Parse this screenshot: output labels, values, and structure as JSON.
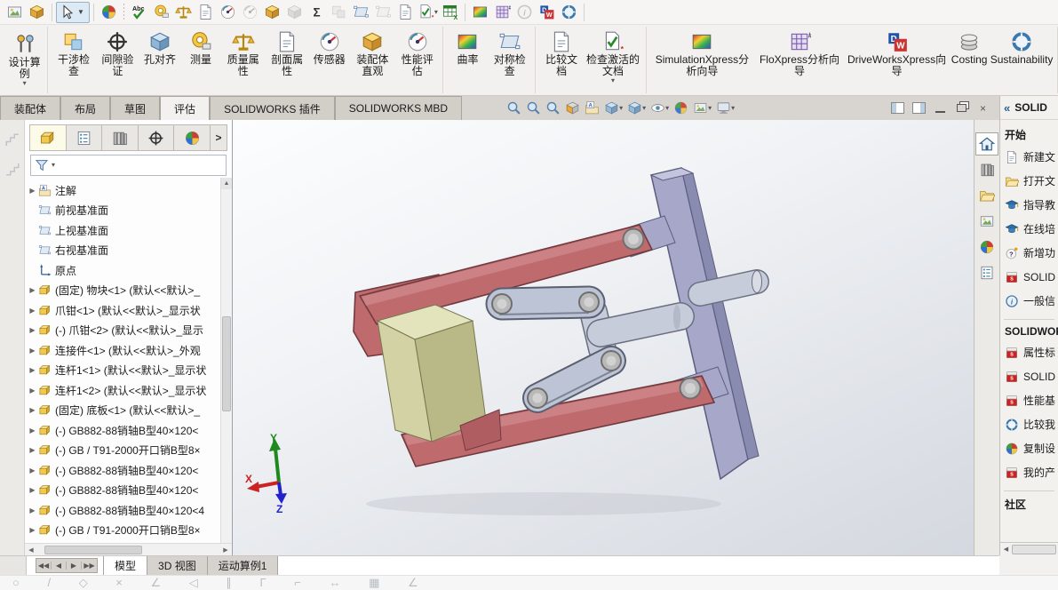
{
  "colors": {
    "model": {
      "arm_red": "#bf6b6e",
      "arm_red_light": "#d28f91",
      "arm_red_dark": "#713a3e",
      "block_top": "#e4e4bc",
      "block_front": "#d2d2a4",
      "block_side": "#b9b987",
      "plate_front": "#a7a8c9",
      "plate_side": "#8a8bb0",
      "plate_top": "#c3c4dd",
      "link": "#bcc4d6",
      "cyl": "#c6ccda",
      "pin": "#b9b9b9",
      "triad_x": "#cc2222",
      "triad_y": "#1e8a1e",
      "triad_z": "#2222cc"
    }
  },
  "top_toolbar": {
    "icon_names": [
      "window-thumbnail",
      "assembly-cube",
      "select-cursor",
      "edit-appearance",
      "spellcheck",
      "measure",
      "mass-properties",
      "section-properties",
      "performance",
      "sensor",
      "check-entity",
      "grayed-cube",
      "equations",
      "grayed-cubes",
      "mirror-components",
      "grayed-mirror",
      "compare-documents",
      "check-active-document",
      "design-table",
      "curvature",
      "floxpress",
      "grayed-check",
      "driveworks",
      "sustainability"
    ]
  },
  "ribbon": {
    "design_study": {
      "label": "设计算例"
    },
    "items": [
      {
        "label": "干涉检查"
      },
      {
        "label": "间隙验证"
      },
      {
        "label": "孔对齐"
      },
      {
        "label": "测量"
      },
      {
        "label": "质量属性"
      },
      {
        "label": "剖面属性"
      },
      {
        "label": "传感器"
      },
      {
        "label": "装配体直观"
      },
      {
        "label": "性能评估"
      },
      {
        "label": "曲率"
      },
      {
        "label": "对称检查"
      },
      {
        "label": "比较文档"
      },
      {
        "label": "检查激活的文档"
      },
      {
        "label": "SimulationXpress分析向导"
      },
      {
        "label": "FloXpress分析向导"
      },
      {
        "label": "DriveWorksXpress向导"
      },
      {
        "label": "Costing"
      },
      {
        "label": "Sustainability"
      }
    ]
  },
  "command_bar": {
    "tabs": [
      {
        "label": "装配体",
        "active": false
      },
      {
        "label": "布局",
        "active": false
      },
      {
        "label": "草图",
        "active": false
      },
      {
        "label": "评估",
        "active": true
      },
      {
        "label": "SOLIDWORKS 插件",
        "active": false
      },
      {
        "label": "SOLIDWORKS MBD",
        "active": false
      }
    ],
    "view_toolbar_icons": [
      "zoom-fit",
      "zoom-area",
      "previous-view",
      "section-view",
      "view-annotations",
      "view-orientation",
      "display-style",
      "hide-show-items",
      "edit-appearance",
      "apply-scene",
      "view-settings"
    ]
  },
  "tree_panel": {
    "tab_icons": [
      "feature-manager",
      "property-manager",
      "configuration-manager",
      "dimxpert-manager",
      "display-manager"
    ],
    "expand_button": ">",
    "items": [
      {
        "label": "注解"
      },
      {
        "label": "前视基准面"
      },
      {
        "label": "上视基准面"
      },
      {
        "label": "右视基准面"
      },
      {
        "label": "原点"
      },
      {
        "label": "(固定) 物块<1> (默认<<默认>_"
      },
      {
        "label": "爪钳<1> (默认<<默认>_显示状"
      },
      {
        "label": "(-) 爪钳<2> (默认<<默认>_显示"
      },
      {
        "label": "连接件<1> (默认<<默认>_外观"
      },
      {
        "label": "连杆1<1> (默认<<默认>_显示状"
      },
      {
        "label": "连杆1<2> (默认<<默认>_显示状"
      },
      {
        "label": "(固定) 底板<1> (默认<<默认>_"
      },
      {
        "label": "(-) GB882-88销轴B型40×120<"
      },
      {
        "label": "(-) GB / T91-2000开口销B型8×"
      },
      {
        "label": "(-) GB882-88销轴B型40×120<"
      },
      {
        "label": "(-) GB882-88销轴B型40×120<"
      },
      {
        "label": "(-) GB882-88销轴B型40×120<4"
      },
      {
        "label": "(-) GB / T91-2000开口销B型8×"
      }
    ]
  },
  "viewport": {
    "triad": {
      "x": "X",
      "y": "Y",
      "z": "Z"
    }
  },
  "task_pane": {
    "title": "SOLID",
    "start": {
      "header": "开始",
      "items": [
        {
          "icon": "new-document-icon",
          "label": "新建文"
        },
        {
          "icon": "open-document-icon",
          "label": "打开文"
        },
        {
          "icon": "tutorials-icon",
          "label": "指导教"
        },
        {
          "icon": "online-training-icon",
          "label": "在线培"
        },
        {
          "icon": "whats-new-icon",
          "label": "新增功"
        },
        {
          "icon": "solidworks-icon",
          "label": "SOLID"
        },
        {
          "icon": "general-info-icon",
          "label": "一般信"
        }
      ]
    },
    "tools": {
      "header": "SOLIDWOR",
      "items": [
        {
          "icon": "property-tab-builder-icon",
          "label": "属性标"
        },
        {
          "icon": "solidworks-tool-icon",
          "label": "SOLID"
        },
        {
          "icon": "benchmark-icon",
          "label": "性能基"
        },
        {
          "icon": "compare-score-icon",
          "label": "比较我"
        },
        {
          "icon": "copy-settings-icon",
          "label": "复制设"
        },
        {
          "icon": "my-products-icon",
          "label": "我的产"
        }
      ]
    },
    "community": {
      "header": "社区"
    }
  },
  "bottom_bar": {
    "tabs": [
      {
        "label": "模型",
        "active": true
      },
      {
        "label": "3D 视图",
        "active": false
      },
      {
        "label": "运动算例1",
        "active": false
      }
    ]
  },
  "sketch_toolbar": {
    "glyph_row": "○ / ◇ × ∠ ◁ ∥ Γ ⌐ ↔ ▦ ∠"
  }
}
